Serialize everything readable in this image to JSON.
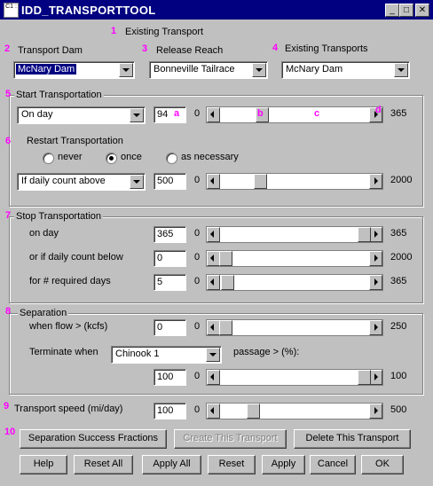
{
  "window": {
    "title": "IDD_TRANSPORTTOOL",
    "icon_text": "C1 :"
  },
  "marks": [
    "1",
    "2",
    "3",
    "4",
    "5",
    "6",
    "7",
    "8",
    "9",
    "10",
    "a",
    "b",
    "c",
    "d"
  ],
  "existing": {
    "header": "Existing Transport"
  },
  "transport_dam": {
    "label": "Transport Dam",
    "value": "McNary Dam"
  },
  "release_reach": {
    "label": "Release Reach",
    "value": "Bonneville Tailrace"
  },
  "existing_transports": {
    "label": "Existing Transports",
    "value": "McNary Dam"
  },
  "start": {
    "title": "Start Transportation",
    "mode": "On day",
    "value": "94",
    "min": "0",
    "max": "365",
    "level": 0.26
  },
  "restart": {
    "title": "Restart Transportation",
    "options": [
      "never",
      "once",
      "as necessary"
    ],
    "selected": 1,
    "mode": "If daily count above",
    "value": "500",
    "min": "0",
    "max": "2000",
    "level": 0.25
  },
  "stop": {
    "title": "Stop Transportation",
    "rows": [
      {
        "label": "on day",
        "value": "365",
        "min": "0",
        "max": "365",
        "level": 1.0
      },
      {
        "label": "or if daily count below",
        "value": "0",
        "min": "0",
        "max": "2000",
        "level": 0.0
      },
      {
        "label": "for # required days",
        "value": "5",
        "min": "0",
        "max": "365",
        "level": 0.014
      }
    ]
  },
  "separation": {
    "title": "Separation",
    "flow_label": "when flow > (kcfs)",
    "flow_value": "0",
    "flow_min": "0",
    "flow_max": "250",
    "flow_level": 0.0,
    "terminate_label": "Terminate when",
    "species": "Chinook 1",
    "passage_label": "passage > (%):",
    "passage_value": "100",
    "passage_min": "0",
    "passage_max": "100",
    "passage_level": 1.0
  },
  "speed": {
    "label": "Transport speed (mi/day)",
    "value": "100",
    "min": "0",
    "max": "500",
    "level": 0.2
  },
  "buttons": {
    "separation_fractions": "Separation Success Fractions",
    "create": "Create This Transport",
    "delete": "Delete This Transport",
    "help": "Help",
    "reset_all": "Reset All",
    "apply_all": "Apply All",
    "reset": "Reset",
    "apply": "Apply",
    "cancel": "Cancel",
    "ok": "OK"
  },
  "colors": {
    "titlebar": "#000080",
    "marker": "#ff00ff",
    "face": "#c0c0c0"
  }
}
